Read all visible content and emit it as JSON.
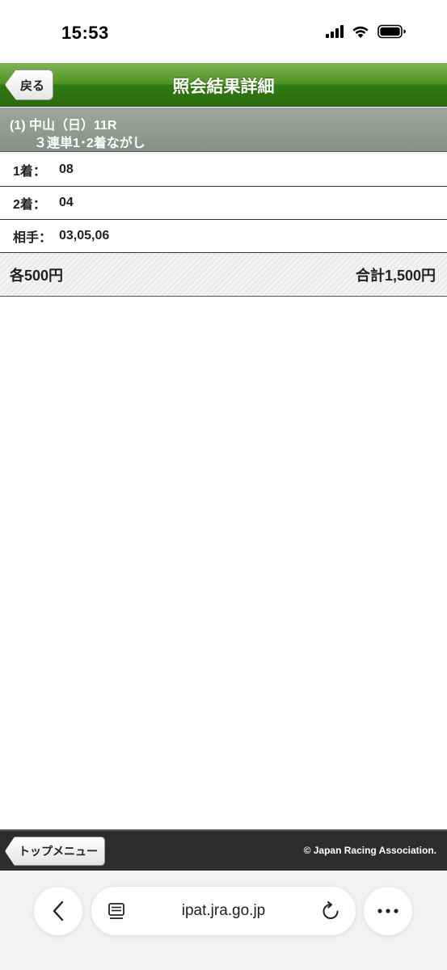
{
  "status_bar": {
    "time": "15:53"
  },
  "header": {
    "back_label": "戻る",
    "title": "照会結果詳細"
  },
  "race": {
    "line1": "(1) 中山（日）11R",
    "line2": "３連単1･2着ながし"
  },
  "rows": [
    {
      "label": "1着：",
      "value": "08"
    },
    {
      "label": "2着：",
      "value": "04"
    },
    {
      "label": "相手：",
      "value": "03,05,06"
    }
  ],
  "totals": {
    "each": "各500円",
    "total": "合計1,500円"
  },
  "footer": {
    "top_menu_label": "トップメニュー",
    "copyright": "© Japan Racing Association."
  },
  "browser": {
    "url": "ipat.jra.go.jp"
  },
  "colors": {
    "header_green": "#2f7a12",
    "banner_gray": "#8c918c",
    "footer_dark": "#2d2d2d"
  }
}
